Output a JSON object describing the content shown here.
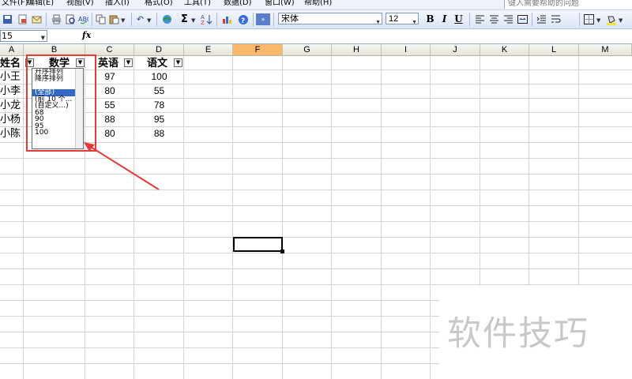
{
  "menu": {
    "items": [
      "文件(F)",
      "编辑(E)",
      "视图(V)",
      "插入(I)",
      "格式(O)",
      "工具(T)",
      "数据(D)",
      "窗口(W)",
      "帮助(H)"
    ],
    "help_placeholder": "键入需要帮助的问题"
  },
  "toolbar": {
    "font_name": "宋体",
    "font_size": "12",
    "bold": "B",
    "italic": "I",
    "underline": "U",
    "sum": "Σ"
  },
  "formula": {
    "namebox": "15",
    "fx": "fx",
    "content": ""
  },
  "columns": [
    "A",
    "B",
    "C",
    "D",
    "E",
    "F",
    "G",
    "H",
    "I",
    "J",
    "K",
    "L",
    "M"
  ],
  "selected_column": "F",
  "table": {
    "headers": [
      "姓名",
      "数学",
      "英语",
      "语文"
    ],
    "names": [
      "小王",
      "小李",
      "小龙",
      "小杨",
      "小陈"
    ],
    "english": [
      "97",
      "80",
      "55",
      "88",
      "80"
    ],
    "chinese": [
      "100",
      "55",
      "78",
      "95",
      "88"
    ]
  },
  "autofilter": {
    "sort_asc": "升序排列",
    "sort_desc": "降序排列",
    "all": "(全部)",
    "top10": "(前 10 个...",
    "custom": "(自定义...)",
    "values": [
      "68",
      "90",
      "95",
      "100"
    ]
  },
  "watermark": "软件技巧",
  "colors": {
    "annotation": "#e33a3a",
    "selection": "#316ac5",
    "selected_column_header": "#f9b86b"
  }
}
